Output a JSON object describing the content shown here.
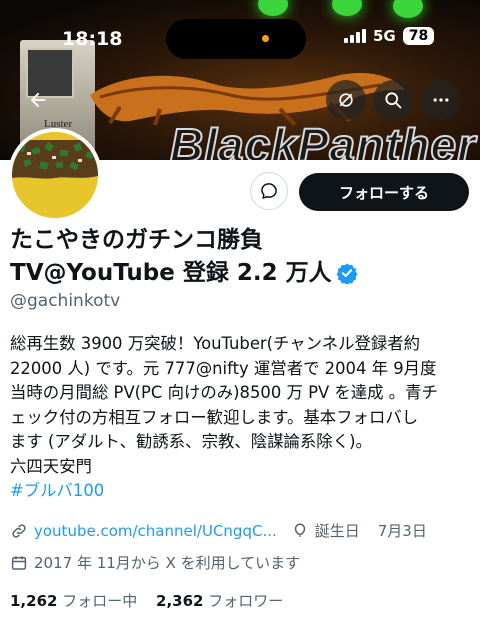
{
  "status_bar": {
    "time": "18:18",
    "network": "5G",
    "battery": "78"
  },
  "banner": {
    "plate_brand": "Luster",
    "big_text": "BlackPanther"
  },
  "profile": {
    "name_line1": "たこやきのガチンコ勝負",
    "name_line2": "TV@YouTube 登録 2.2 万人",
    "handle": "@gachinkotv",
    "bio_lines": [
      "総再生数 3900 万突破！YouTuber(チャンネル登録者約",
      "22000 人) です。元 777@nifty 運営者で 2004 年 9月度",
      "当時の月間総 PV(PC 向けのみ)8500 万 PV を達成 。青チ",
      "ェック付の方相互フォロー歓迎します。基本フォロバし",
      "ます (アダルト、勧誘系、宗教、陰謀論系除く)。",
      "六四天安門"
    ],
    "hashtag": "#ブルバ100",
    "link": "youtube.com/channel/UCngqC...",
    "birthday_label": "誕生日",
    "birthday_value": "7月3日",
    "joined": "2017 年 11月から X を利用しています",
    "following_count": "1,262",
    "following_label": "フォロー中",
    "followers_count": "2,362",
    "followers_label": "フォロワー"
  },
  "actions": {
    "follow_label": "フォローする"
  },
  "colors": {
    "accent": "#1d9bf0",
    "text": "#0f1419",
    "secondary": "#536471",
    "button_dark": "#0f1419"
  },
  "icons": [
    "back-arrow-icon",
    "no-notification-icon",
    "search-icon",
    "more-icon",
    "message-icon",
    "verified-badge-icon",
    "link-icon",
    "balloon-icon",
    "calendar-icon"
  ]
}
